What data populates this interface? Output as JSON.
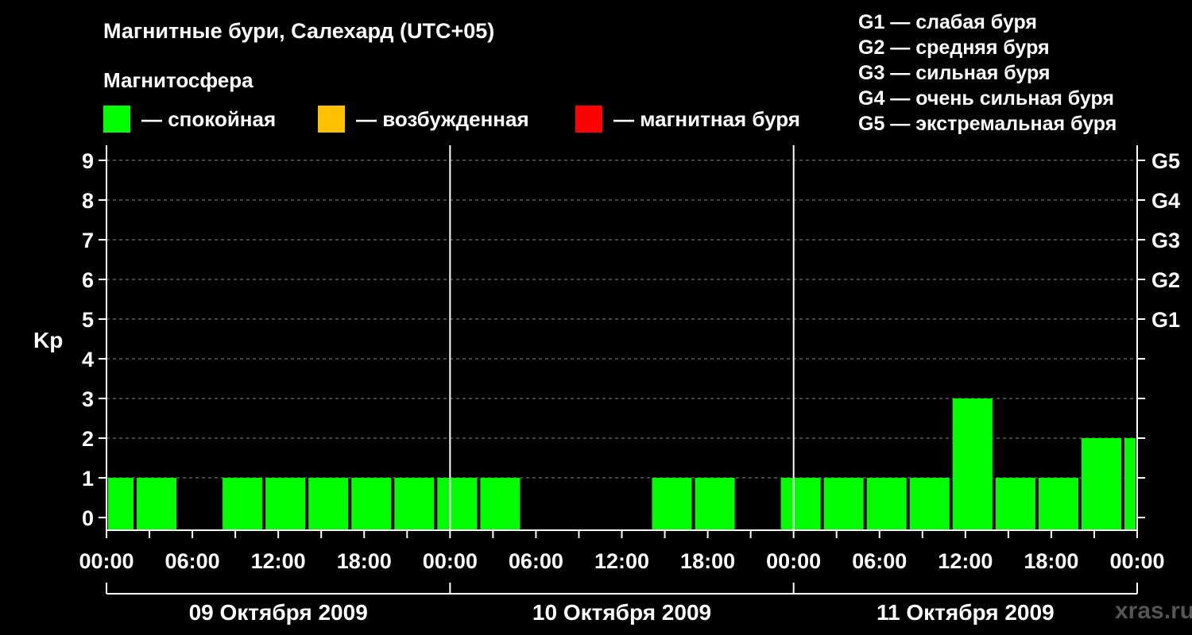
{
  "title": "Магнитные бури, Салехард (UTC+05)",
  "subtitle": "Магнитосфера",
  "legend": [
    {
      "label": "— спокойная",
      "color": "#00ff00"
    },
    {
      "label": "— возбужденная",
      "color": "#ffc000"
    },
    {
      "label": "— магнитная буря",
      "color": "#ff0000"
    }
  ],
  "storm_levels": [
    "G1 — слабая буря",
    "G2 — средняя буря",
    "G3 — сильная буря",
    "G4 — очень сильная буря",
    "G5 — экстремальная буря"
  ],
  "watermark": "xras.ru",
  "chart_data": {
    "type": "bar",
    "ylabel": "Kp",
    "ylim": [
      0,
      9
    ],
    "yticks": [
      0,
      1,
      2,
      3,
      4,
      5,
      6,
      7,
      8,
      9
    ],
    "right_ticks": [
      {
        "value": 5,
        "label": "G1"
      },
      {
        "value": 6,
        "label": "G2"
      },
      {
        "value": 7,
        "label": "G3"
      },
      {
        "value": 8,
        "label": "G4"
      },
      {
        "value": 9,
        "label": "G5"
      }
    ],
    "x_range_hours": [
      0,
      72
    ],
    "x_tick_labels": [
      "00:00",
      "06:00",
      "12:00",
      "18:00",
      "00:00",
      "06:00",
      "12:00",
      "18:00",
      "00:00",
      "06:00",
      "12:00",
      "18:00",
      "00:00"
    ],
    "days": [
      "09 Октября 2009",
      "10 Октября 2009",
      "11 Октября 2009"
    ],
    "grid": true,
    "bars": [
      {
        "start": 0,
        "end": 2,
        "kp": 1,
        "color": "#00ff00"
      },
      {
        "start": 2,
        "end": 5,
        "kp": 1,
        "color": "#00ff00"
      },
      {
        "start": 8,
        "end": 11,
        "kp": 1,
        "color": "#00ff00"
      },
      {
        "start": 11,
        "end": 14,
        "kp": 1,
        "color": "#00ff00"
      },
      {
        "start": 14,
        "end": 17,
        "kp": 1,
        "color": "#00ff00"
      },
      {
        "start": 17,
        "end": 20,
        "kp": 1,
        "color": "#00ff00"
      },
      {
        "start": 20,
        "end": 23,
        "kp": 1,
        "color": "#00ff00"
      },
      {
        "start": 23,
        "end": 26,
        "kp": 1,
        "color": "#00ff00"
      },
      {
        "start": 26,
        "end": 29,
        "kp": 1,
        "color": "#00ff00"
      },
      {
        "start": 38,
        "end": 41,
        "kp": 1,
        "color": "#00ff00"
      },
      {
        "start": 41,
        "end": 44,
        "kp": 1,
        "color": "#00ff00"
      },
      {
        "start": 47,
        "end": 50,
        "kp": 1,
        "color": "#00ff00"
      },
      {
        "start": 50,
        "end": 53,
        "kp": 1,
        "color": "#00ff00"
      },
      {
        "start": 53,
        "end": 56,
        "kp": 1,
        "color": "#00ff00"
      },
      {
        "start": 56,
        "end": 59,
        "kp": 1,
        "color": "#00ff00"
      },
      {
        "start": 59,
        "end": 62,
        "kp": 3,
        "color": "#00ff00"
      },
      {
        "start": 62,
        "end": 65,
        "kp": 1,
        "color": "#00ff00"
      },
      {
        "start": 65,
        "end": 68,
        "kp": 1,
        "color": "#00ff00"
      },
      {
        "start": 68,
        "end": 71,
        "kp": 2,
        "color": "#00ff00"
      },
      {
        "start": 71,
        "end": 72,
        "kp": 2,
        "color": "#00ff00"
      }
    ]
  }
}
